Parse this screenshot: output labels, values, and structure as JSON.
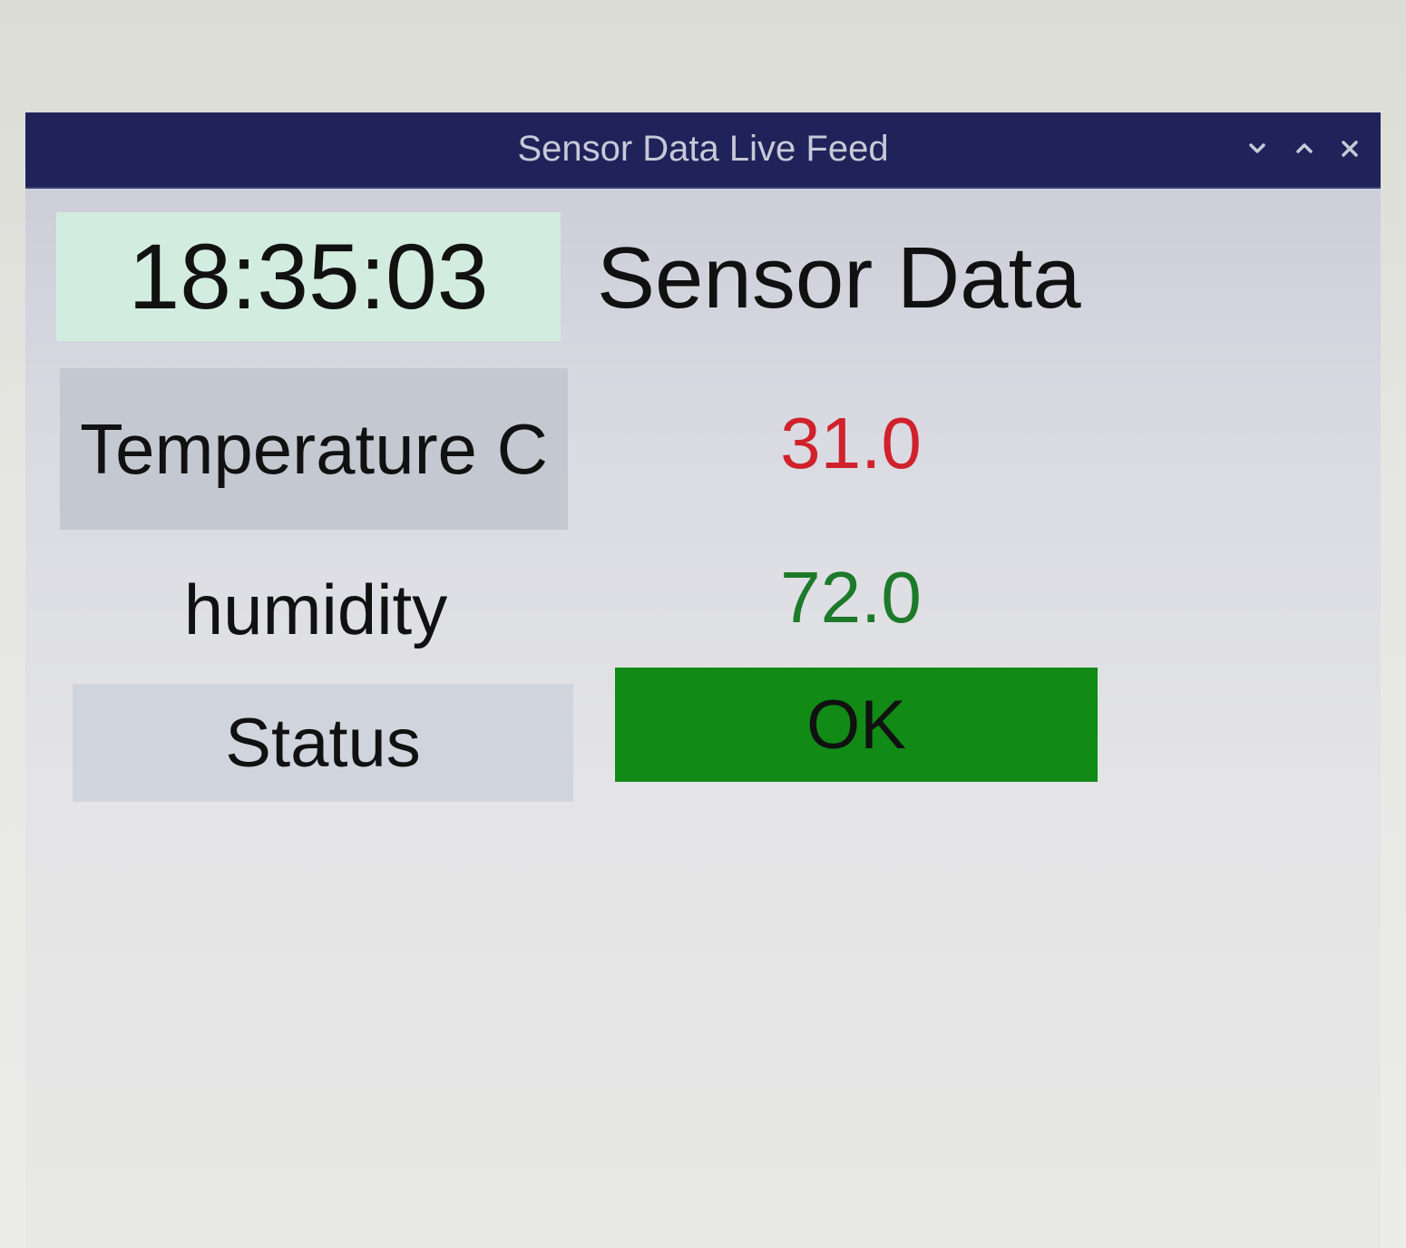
{
  "window": {
    "title": "Sensor Data Live Feed",
    "controls": {
      "minimize_icon": "chevron-down-icon",
      "maximize_icon": "chevron-up-icon",
      "close_icon": "close-icon"
    }
  },
  "clock": {
    "time": "18:35:03"
  },
  "heading": "Sensor Data",
  "readings": {
    "temperature": {
      "label": "Temperature C",
      "value": "31.0",
      "value_color": "#d0222c"
    },
    "humidity": {
      "label": "humidity",
      "value": "72.0",
      "value_color": "#1d7a2a"
    },
    "status": {
      "label": "Status",
      "value": "OK",
      "background_color": "#118a16"
    }
  },
  "colors": {
    "titlebar": "#1f2359",
    "clock_background": "#d3ece0",
    "label_background": "#c4c8d0"
  }
}
